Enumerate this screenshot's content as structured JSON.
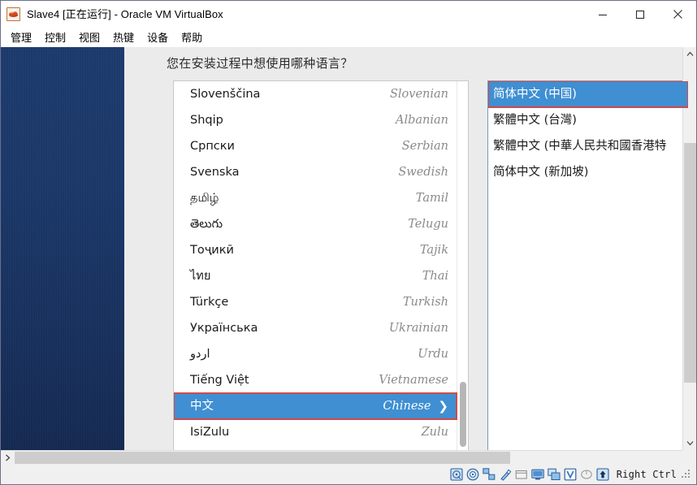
{
  "window": {
    "title": "Slave4 [正在运行] - Oracle VM VirtualBox",
    "icon": "virtualbox-vm-icon",
    "controls": {
      "minimize": "minimize-icon",
      "maximize": "maximize-icon",
      "close": "close-icon"
    }
  },
  "menubar": {
    "items": [
      {
        "label": "管理"
      },
      {
        "label": "控制"
      },
      {
        "label": "视图"
      },
      {
        "label": "热键"
      },
      {
        "label": "设备"
      },
      {
        "label": "帮助"
      }
    ]
  },
  "guest": {
    "question": "您在安装过程中想使用哪种语言？",
    "language_list": [
      {
        "native": "Slovenščina",
        "english": "Slovenian",
        "selected": false
      },
      {
        "native": "Shqip",
        "english": "Albanian",
        "selected": false
      },
      {
        "native": "Српски",
        "english": "Serbian",
        "selected": false
      },
      {
        "native": "Svenska",
        "english": "Swedish",
        "selected": false
      },
      {
        "native": "தமிழ்",
        "english": "Tamil",
        "selected": false
      },
      {
        "native": "తెలుగు",
        "english": "Telugu",
        "selected": false
      },
      {
        "native": "Тоҷикӣ",
        "english": "Tajik",
        "selected": false
      },
      {
        "native": "ไทย",
        "english": "Thai",
        "selected": false
      },
      {
        "native": "Türkçe",
        "english": "Turkish",
        "selected": false
      },
      {
        "native": "Українська",
        "english": "Ukrainian",
        "selected": false
      },
      {
        "native": "اردو",
        "english": "Urdu",
        "selected": false
      },
      {
        "native": "Tiếng Việt",
        "english": "Vietnamese",
        "selected": false
      },
      {
        "native": "中文",
        "english": "Chinese",
        "selected": true
      },
      {
        "native": "IsiZulu",
        "english": "Zulu",
        "selected": false
      }
    ],
    "variant_list": [
      {
        "label": "简体中文 (中国)",
        "selected": true
      },
      {
        "label": "繁體中文 (台灣)",
        "selected": false
      },
      {
        "label": "繁體中文 (中華人民共和國香港特",
        "selected": false
      },
      {
        "label": "简体中文 (新加坡)",
        "selected": false
      }
    ]
  },
  "statusbar": {
    "icons": [
      {
        "name": "hard-disk-icon"
      },
      {
        "name": "optical-disk-icon"
      },
      {
        "name": "network-icon"
      },
      {
        "name": "usb-icon"
      },
      {
        "name": "shared-folders-icon"
      },
      {
        "name": "display-icon"
      },
      {
        "name": "video-capture-icon"
      },
      {
        "name": "virtualization-icon"
      },
      {
        "name": "mouse-icon"
      },
      {
        "name": "keyboard-icon"
      }
    ],
    "host_key": "Right Ctrl"
  },
  "colors": {
    "selection_blue": "#3f8fd2",
    "highlight_red": "#d04a4a",
    "desktop_blue": "#1b3869",
    "chrome_gray": "#f0f0f0",
    "page_gray": "#ebebeb"
  }
}
